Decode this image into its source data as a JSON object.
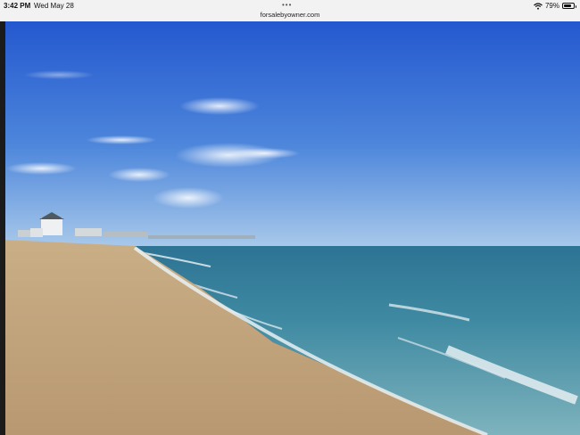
{
  "status_bar": {
    "time": "3:42 PM",
    "date": "Wed May 28",
    "url": "forsalebyowner.com",
    "battery_percent": "79%",
    "battery_level": 0.79,
    "icons": [
      "more-dots-icon",
      "wifi-icon",
      "battery-icon"
    ]
  },
  "photo": {
    "subject": "beach-photo",
    "colors": {
      "sky_top": "#2a62d6",
      "sky_horizon": "#9ec4ea",
      "sea_far": "#2f7ea0",
      "sea_near": "#6aa9b9",
      "sand": "#c7a87f",
      "foam": "#eef4f6"
    }
  }
}
